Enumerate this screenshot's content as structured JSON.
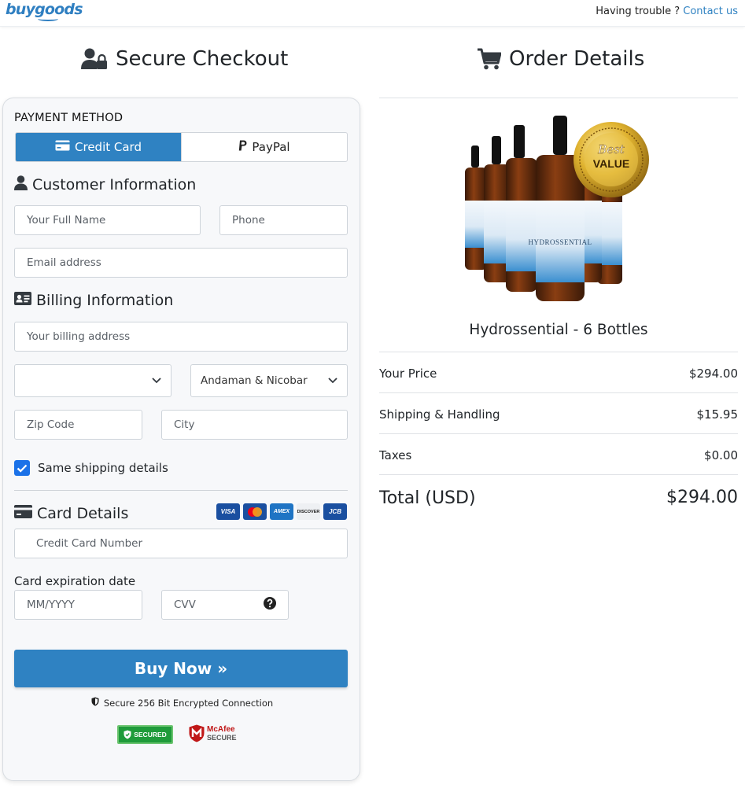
{
  "header": {
    "logo": "buygoods",
    "trouble_text": "Having trouble ? ",
    "contact_link": "Contact us"
  },
  "checkout": {
    "title": "Secure Checkout",
    "payment_method_label": "PAYMENT METHOD",
    "tabs": [
      {
        "label": "Credit Card",
        "active": true
      },
      {
        "label": "PayPal",
        "active": false
      }
    ],
    "customer_info_title": "Customer Information",
    "full_name_placeholder": "Your Full Name",
    "phone_placeholder": "Phone",
    "email_placeholder": "Email address",
    "billing_info_title": "Billing Information",
    "billing_address_placeholder": "Your billing address",
    "country_value": "",
    "state_value": "Andaman & Nicobar",
    "zip_placeholder": "Zip Code",
    "city_placeholder": "City",
    "same_shipping_label": "Same shipping details",
    "same_shipping_checked": true,
    "card_details_title": "Card Details",
    "card_brands": [
      "VISA",
      "MC",
      "AMEX",
      "DISCOVER",
      "JCB"
    ],
    "card_number_placeholder": "Credit Card Number",
    "expiration_label": "Card expiration date",
    "expiry_placeholder": "MM/YYYY",
    "cvv_placeholder": "CVV",
    "buy_button": "Buy Now »",
    "secure_text": "Secure 256 Bit Encrypted Connection",
    "badge_secured": "SECURED",
    "badge_mcafee_top": "McAfee",
    "badge_mcafee_bottom": "SECURE"
  },
  "order": {
    "title": "Order Details",
    "product_badge_top": "Best",
    "product_badge_bottom": "VALUE",
    "product_label_text": "HYDROSSENTIAL",
    "product_name": "Hydrossential - 6 Bottles",
    "rows": [
      {
        "label": "Your Price",
        "value": "$294.00"
      },
      {
        "label": "Shipping & Handling",
        "value": "$15.95"
      },
      {
        "label": "Taxes",
        "value": "$0.00"
      }
    ],
    "total_label": "Total (USD)",
    "total_value": "$294.00"
  },
  "colors": {
    "accent": "#2f82c2",
    "checkbox": "#1b72e8",
    "secured_green": "#1f9b3a",
    "mcafee_red": "#c01818"
  }
}
